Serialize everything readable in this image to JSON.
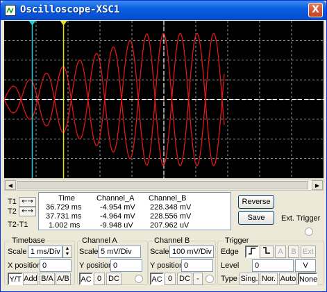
{
  "window": {
    "title": "Oscilloscope-XSC1",
    "close_glyph": "X"
  },
  "cursors": {
    "t1_color": "#28c8d8",
    "t2_color": "#e8e020"
  },
  "trace": {
    "color": "#e01818",
    "grid_color": "#ffffff",
    "background": "#000000"
  },
  "cursor_controls": {
    "t1": "T1",
    "t2": "T2",
    "t2_t1": "T2-T1",
    "left": "←",
    "right": "→"
  },
  "readout": {
    "headers": {
      "time": "Time",
      "channel_a": "Channel_A",
      "channel_b": "Channel_B"
    },
    "rows": [
      {
        "time": "36.729 ms",
        "channel_a": "-4.954 mV",
        "channel_b": "228.348 mV"
      },
      {
        "time": "37.731 ms",
        "channel_a": "-4.964 mV",
        "channel_b": "228.556 mV"
      },
      {
        "time": "1.002 ms",
        "channel_a": "-9.948 uV",
        "channel_b": "207.962 uV"
      }
    ]
  },
  "buttons": {
    "reverse": "Reverse",
    "save": "Save",
    "ext_trigger": "Ext. Trigger"
  },
  "timebase": {
    "title": "Timebase",
    "scale_label": "Scale",
    "scale_value": "1 ms/Div",
    "xpos_label": "X position",
    "xpos_value": "0",
    "modes": [
      "Y/T",
      "Add",
      "B/A",
      "A/B"
    ]
  },
  "channel_a": {
    "title": "Channel A",
    "scale_label": "Scale",
    "scale_value": "5 mV/Div",
    "ypos_label": "Y position",
    "ypos_value": "0",
    "coupling": [
      "AC",
      "0",
      "DC"
    ]
  },
  "channel_b": {
    "title": "Channel B",
    "scale_label": "Scale",
    "scale_value": "100 mV/Div",
    "ypos_label": "Y position",
    "ypos_value": "0",
    "coupling": [
      "AC",
      "0",
      "DC",
      "-"
    ]
  },
  "trigger": {
    "title": "Trigger",
    "edge_label": "Edge",
    "edge_buttons": [
      "A",
      "B",
      "Ext"
    ],
    "level_label": "Level",
    "level_value": "0",
    "level_unit": "V",
    "type_label": "Type",
    "types": [
      "Sing.",
      "Nor.",
      "Auto",
      "None"
    ]
  }
}
